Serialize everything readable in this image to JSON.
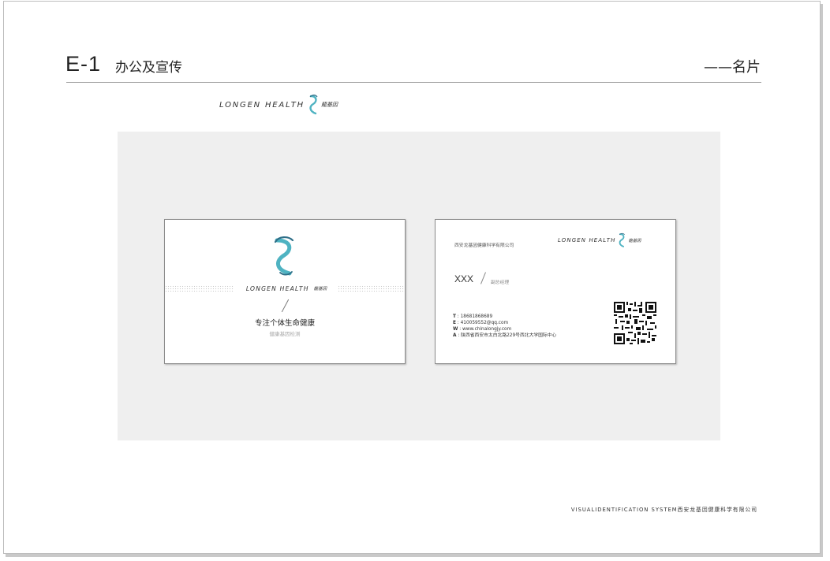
{
  "header": {
    "section_code": "E-1",
    "section_title": "办公及宣传",
    "section_subtitle": "——名片"
  },
  "brand": {
    "logo_text": "LONGEN HEALTH",
    "logo_cn": "龍基因"
  },
  "card_front": {
    "slogan": "专注个体生命健康",
    "sub": "健康基因检测"
  },
  "card_back": {
    "company": "西安龙基因健康科学有限公司",
    "name": "XXX",
    "role": "副总经理",
    "contacts": [
      {
        "key": "T",
        "value": "18681868689"
      },
      {
        "key": "E",
        "value": "410059552@qq.com"
      },
      {
        "key": "W",
        "value": "www.chinalongjy.com"
      },
      {
        "key": "A",
        "value": "陕西省西安市太白北路229号西北大学国际中心"
      }
    ]
  },
  "footer": {
    "text": "VISUALIDENTIFICATION SYSTEM西安龙基因健康科学有限公司"
  },
  "colors": {
    "accent": "#4fb3c2",
    "accent_dark": "#2f6f88",
    "panel": "#efefef"
  }
}
